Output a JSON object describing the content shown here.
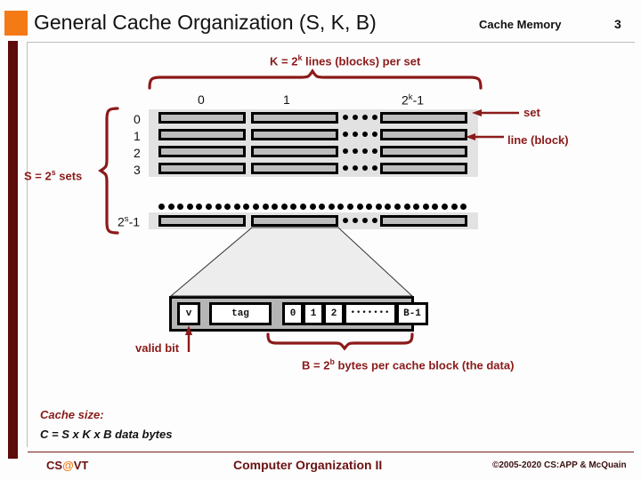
{
  "header": {
    "title": "General Cache Organization (S, K, B)",
    "subject": "Cache Memory",
    "page_number": "3"
  },
  "diagram": {
    "k_caption_pre": "K = 2",
    "k_caption_sup": "k",
    "k_caption_post": " lines (blocks) per set",
    "s_caption_pre": "S = 2",
    "s_caption_sup": "s",
    "s_caption_post": " sets",
    "set_label": "set",
    "line_label": "line (block)",
    "valid_bit_label": "valid bit",
    "b_caption_pre": "B = 2",
    "b_caption_sup": "b",
    "b_caption_post": " bytes per cache block (the data)",
    "column_headers": [
      "0",
      "1",
      "2k-1"
    ],
    "column_header_last_pre": "2",
    "column_header_last_sup": "k",
    "column_header_last_post": "-1",
    "row_labels": [
      "0",
      "1",
      "2",
      "3"
    ],
    "row_label_last_pre": "2",
    "row_label_last_sup": "s",
    "row_label_last_post": "-1"
  },
  "detail_block": {
    "valid_cell": "v",
    "tag_cell": "tag",
    "byte_cells": [
      "0",
      "1",
      "2"
    ],
    "ellipsis_cell": "•••••••",
    "last_byte_cell": "B-1"
  },
  "cache_size": {
    "title": "Cache size:",
    "equation": "C = S x K x B data bytes"
  },
  "footer": {
    "logo_pre": "CS",
    "logo_at": "@",
    "logo_post": "VT",
    "center": "Computer Organization II",
    "right": "©2005-2020 CS:APP & McQuain"
  },
  "colors": {
    "accent_orange": "#F47A16",
    "dark_red": "#5E0B0B",
    "caption_red": "#8B1A1A",
    "cell_gray": "#bdbdbd",
    "band_gray": "#e2e2e2"
  }
}
